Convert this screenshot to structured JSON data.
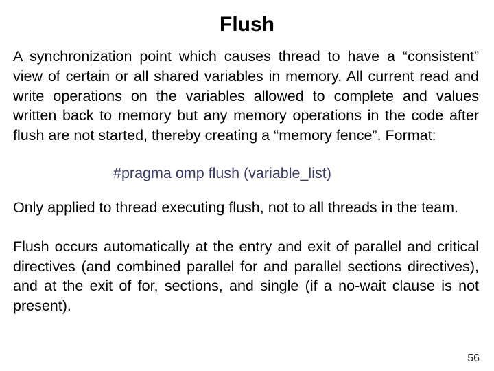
{
  "slide": {
    "title": "Flush",
    "paragraph_1": "A synchronization point which causes thread to have a “consistent” view of certain or all shared variables in memory. All current read and write operations on the variables allowed to complete and values written back to memory but any memory operations in the code after flush are not started, thereby creating a “memory fence”. Format:",
    "code_directive": "#pragma omp flush (variable_list)",
    "paragraph_2": "Only applied to thread executing flush, not to all threads in the team.",
    "paragraph_3": "Flush occurs automatically at the entry and exit of parallel and critical directives (and combined parallel for and parallel sections directives), and at the exit of for, sections, and single (if a no-wait clause is not present).",
    "page_number": "56",
    "colors": {
      "background": "#ffffff",
      "title_text": "#000000",
      "body_text": "#000000",
      "code_text": "#3b3b6b",
      "page_number_text": "#262626"
    }
  }
}
